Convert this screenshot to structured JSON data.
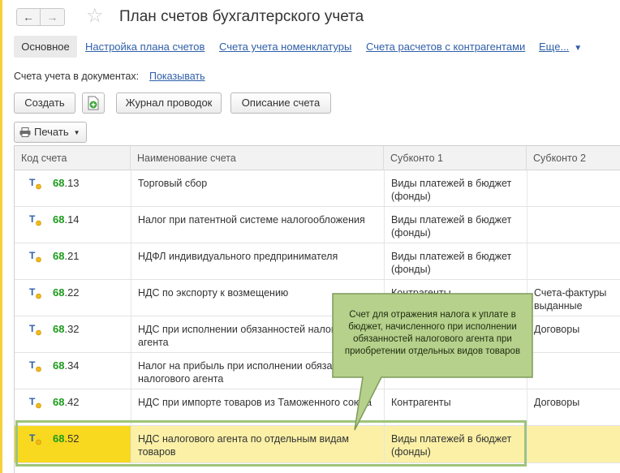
{
  "window": {
    "title": "План счетов бухгалтерского учета",
    "back_icon": "←",
    "forward_icon": "→",
    "favorite_icon": "☆"
  },
  "tabs": {
    "main": "Основное",
    "links": [
      "Настройка плана счетов",
      "Счета учета номенклатуры",
      "Счета расчетов с контрагентами",
      "Еще..."
    ]
  },
  "documents": {
    "label": "Счета учета в документах:",
    "link": "Показывать"
  },
  "toolbar": {
    "create": "Создать",
    "journal": "Журнал проводок",
    "description": "Описание счета",
    "print": "Печать"
  },
  "table": {
    "columns": [
      "Код счета",
      "Наименование счета",
      "Субконто 1",
      "Субконто 2"
    ],
    "rows": [
      {
        "code_main": "68",
        "code_sub": ".13",
        "name": "Торговый сбор",
        "sub1": "Виды платежей в бюджет (фонды)",
        "sub2": ""
      },
      {
        "code_main": "68",
        "code_sub": ".14",
        "name": "Налог при патентной системе налогообложения",
        "sub1": "Виды платежей в бюджет (фонды)",
        "sub2": ""
      },
      {
        "code_main": "68",
        "code_sub": ".21",
        "name": "НДФЛ индивидуального предпринимателя",
        "sub1": "Виды платежей в бюджет (фонды)",
        "sub2": ""
      },
      {
        "code_main": "68",
        "code_sub": ".22",
        "name": "НДС по экспорту к возмещению",
        "sub1": "Контрагенты",
        "sub2": "Счета-фактуры выданные"
      },
      {
        "code_main": "68",
        "code_sub": ".32",
        "name": "НДС при исполнении обязанностей налогового агента",
        "sub1": "",
        "sub2": "Договоры"
      },
      {
        "code_main": "68",
        "code_sub": ".34",
        "name": "Налог на прибыль при исполнении обязанностей налогового агента",
        "sub1": "",
        "sub2": ""
      },
      {
        "code_main": "68",
        "code_sub": ".42",
        "name": "НДС при импорте товаров из Таможенного союза",
        "sub1": "Контрагенты",
        "sub2": "Договоры"
      },
      {
        "code_main": "68",
        "code_sub": ".52",
        "name": "НДС налогового агента по отдельным видам товаров",
        "sub1": "Виды платежей в бюджет (фонды)",
        "sub2": ""
      }
    ]
  },
  "callout": {
    "text": "Счет для отражения налога к уплате в бюджет, начисленного при исполнении обязанностей налогового агента при приобретении отдельных видов товаров"
  },
  "colors": {
    "link": "#2f5fa8",
    "code_green": "#1a9b1a",
    "selected_row": "#fbf0a6",
    "selected_cell": "#f8d91f",
    "callout_fill": "#b5d18c",
    "frame": "#9ec47a"
  }
}
